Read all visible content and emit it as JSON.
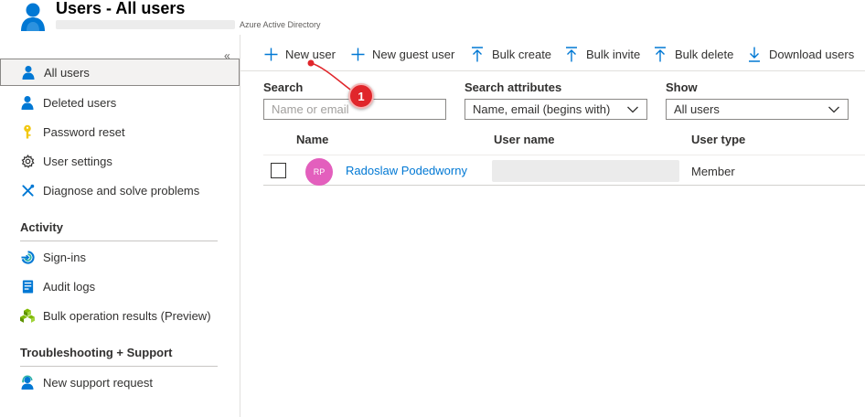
{
  "header": {
    "title": "Users - All users",
    "subtitle": "Azure Active Directory"
  },
  "sidebar": {
    "items": [
      {
        "label": "All users",
        "icon": "user-icon",
        "active": true
      },
      {
        "label": "Deleted users",
        "icon": "user-icon"
      },
      {
        "label": "Password reset",
        "icon": "key-icon"
      },
      {
        "label": "User settings",
        "icon": "gear-icon"
      },
      {
        "label": "Diagnose and solve problems",
        "icon": "wrench-icon"
      }
    ],
    "sections": [
      {
        "title": "Activity",
        "items": [
          {
            "label": "Sign-ins",
            "icon": "sign-in-icon"
          },
          {
            "label": "Audit logs",
            "icon": "audit-log-icon"
          },
          {
            "label": "Bulk operation results (Preview)",
            "icon": "bulk-operation-icon"
          }
        ]
      },
      {
        "title": "Troubleshooting + Support",
        "items": [
          {
            "label": "New support request",
            "icon": "support-agent-icon"
          }
        ]
      }
    ]
  },
  "toolbar": {
    "new_user": "New user",
    "new_guest_user": "New guest user",
    "bulk_create": "Bulk create",
    "bulk_invite": "Bulk invite",
    "bulk_delete": "Bulk delete",
    "download_users": "Download users"
  },
  "filters": {
    "search_label": "Search",
    "search_placeholder": "Name or email",
    "search_attributes_label": "Search attributes",
    "search_attributes_value": "Name, email (begins with)",
    "show_label": "Show",
    "show_value": "All users"
  },
  "table": {
    "columns": [
      "Name",
      "User name",
      "User type"
    ],
    "rows": [
      {
        "initials": "RP",
        "name": "Radoslaw Podedworny",
        "user_type": "Member"
      }
    ]
  },
  "annotation": {
    "callout_number": "1"
  },
  "colors": {
    "accent": "#0078d4",
    "avatar": "#e35fbd",
    "callout": "#e0262b"
  }
}
